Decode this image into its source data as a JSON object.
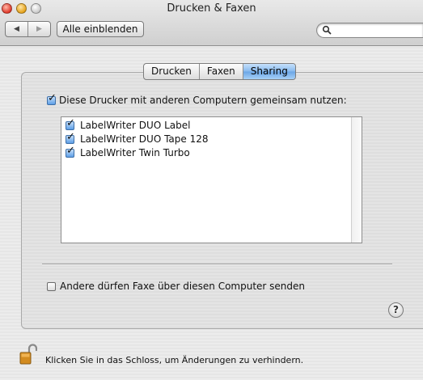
{
  "window": {
    "title": "Drucken & Faxen"
  },
  "toolbar": {
    "back_icon": "◀",
    "forward_icon": "▶",
    "show_all_label": "Alle einblenden",
    "search": {
      "placeholder": "",
      "value": ""
    }
  },
  "tabs": [
    {
      "label": "Drucken",
      "active": false
    },
    {
      "label": "Faxen",
      "active": false
    },
    {
      "label": "Sharing",
      "active": true
    }
  ],
  "sharing": {
    "share_printers_label": "Diese Drucker mit anderen Computern gemeinsam nutzen:",
    "share_printers_checked": true,
    "printers": [
      {
        "name": "LabelWriter DUO Label",
        "checked": true
      },
      {
        "name": "LabelWriter DUO Tape 128",
        "checked": true
      },
      {
        "name": "LabelWriter Twin Turbo",
        "checked": true
      }
    ],
    "fax_label": "Andere dürfen Faxe über diesen Computer senden",
    "fax_checked": false
  },
  "help": {
    "label": "?"
  },
  "footer": {
    "lock_text": "Klicken Sie in das Schloss, um Änderungen zu verhindern."
  },
  "colors": {
    "accent_tab": "#6aa5e6",
    "checkbox_on": "#5d9ee6",
    "close": "#e0392b",
    "minimize": "#e5a21a"
  }
}
